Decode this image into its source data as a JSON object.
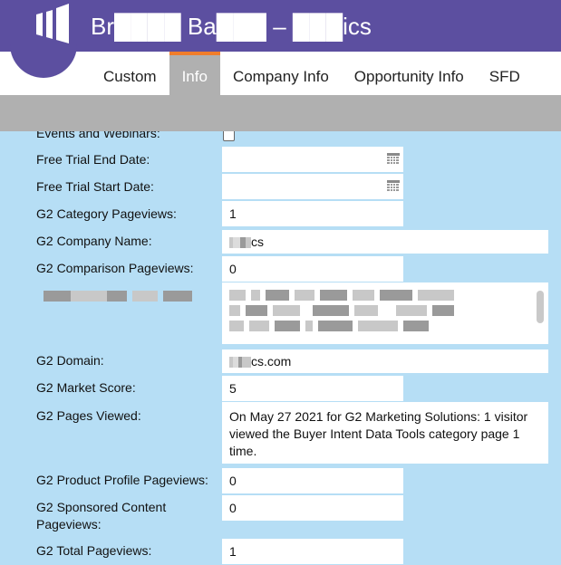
{
  "header": {
    "app_title": "Br████ Ba███ – ███ics",
    "tabs": [
      {
        "label": "Custom",
        "active": false
      },
      {
        "label": "Info",
        "active": true
      },
      {
        "label": "Company Info",
        "active": false
      },
      {
        "label": "Opportunity Info",
        "active": false
      },
      {
        "label": "SFD",
        "active": false
      }
    ]
  },
  "form": {
    "events_webinars_label": "Events and Webinars:",
    "free_trial_end_label": "Free Trial End Date:",
    "free_trial_end_value": "",
    "free_trial_start_label": "Free Trial Start Date:",
    "free_trial_start_value": "",
    "g2_category_pageviews_label": "G2 Category Pageviews:",
    "g2_category_pageviews_value": "1",
    "g2_company_name_label": "G2 Company Name:",
    "g2_company_name_value": "cs",
    "g2_comparison_pageviews_label": "G2 Comparison Pageviews:",
    "g2_comparison_pageviews_value": "0",
    "g2_domain_label": "G2 Domain:",
    "g2_domain_value": "cs.com",
    "g2_market_score_label": "G2 Market Score:",
    "g2_market_score_value": "5",
    "g2_pages_viewed_label": "G2 Pages Viewed:",
    "g2_pages_viewed_value": "On May 27 2021 for G2 Marketing Solutions: 1 visitor viewed the Buyer Intent Data Tools category page 1 time.",
    "g2_product_profile_pageviews_label": "G2 Product Profile Pageviews:",
    "g2_product_profile_pageviews_value": "0",
    "g2_sponsored_content_pageviews_label": "G2 Sponsored Content Pageviews:",
    "g2_sponsored_content_pageviews_value": "0",
    "g2_total_pageviews_label": "G2 Total Pageviews:",
    "g2_total_pageviews_value": "1"
  },
  "colors": {
    "brand_purple": "#5c4fa0",
    "active_tab_accent": "#f07d2b",
    "form_background": "#b6def5",
    "band_gray": "#b0b0b0"
  },
  "icons": [
    "brand-logo-icon",
    "calendar-icon"
  ]
}
